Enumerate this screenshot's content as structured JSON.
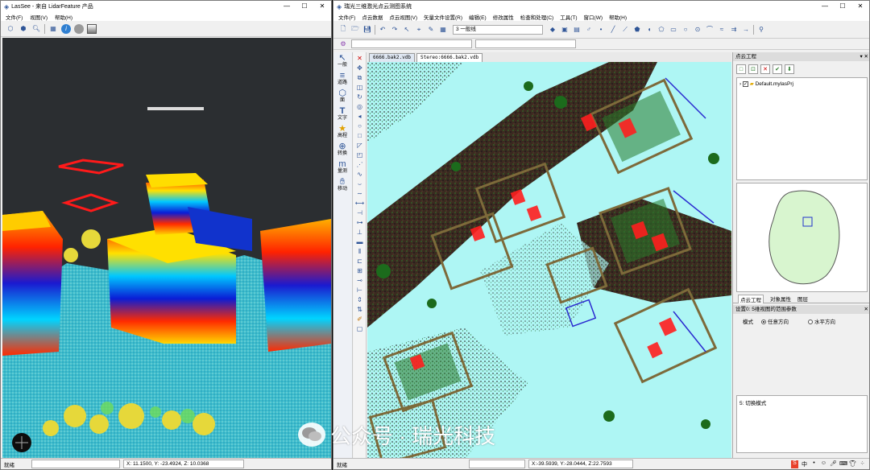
{
  "left_window": {
    "title": "LasSee - 来自 LidarFeature 产品",
    "menu": [
      "文件(F)",
      "视图(V)",
      "帮助(H)"
    ],
    "status": {
      "label": "就绪",
      "coords": "X: 11.1500, Y: -23.4924, Z: 10.0368"
    }
  },
  "right_window": {
    "title": "瑞光三维激光点云测图系统",
    "menu": [
      "文件(F)",
      "点云数据",
      "点云视图(V)",
      "矢量文件设置(R)",
      "编辑(E)",
      "修改属性",
      "检查和处理(C)",
      "工具(T)",
      "窗口(W)",
      "帮助(H)"
    ],
    "layer_select": "3 一般线",
    "modes": [
      {
        "icon": "pointer-icon",
        "label": "一般"
      },
      {
        "icon": "road-icon",
        "label": "道路"
      },
      {
        "icon": "shape-icon",
        "label": "面"
      },
      {
        "icon": "text-icon",
        "label": "文字"
      },
      {
        "icon": "star-icon",
        "label": "高程"
      },
      {
        "icon": "convert-icon",
        "label": "转换"
      },
      {
        "icon": "measure-icon",
        "label": "量测"
      },
      {
        "icon": "pan-icon",
        "label": "移动"
      }
    ],
    "doc_tabs": [
      "6666.bak2.vdb",
      "Stereo:6666.bak2.vdb"
    ],
    "panel": {
      "title": "点云工程",
      "tree_item": "Default.mylasPrj",
      "tabs": [
        "点云工程",
        "对象属性",
        "图层"
      ],
      "settings_title": "设置0: 5维视图的范围参数",
      "mode_label": "模式",
      "radio_options": [
        "任意方向",
        "水平方向"
      ],
      "log_text": "5:  切换模式"
    },
    "status": {
      "label": "就绪",
      "coords": "X:-39.5939, Y:-28.0444, Z:22.7593"
    }
  },
  "watermark": "公众号 · 瑞光科技"
}
